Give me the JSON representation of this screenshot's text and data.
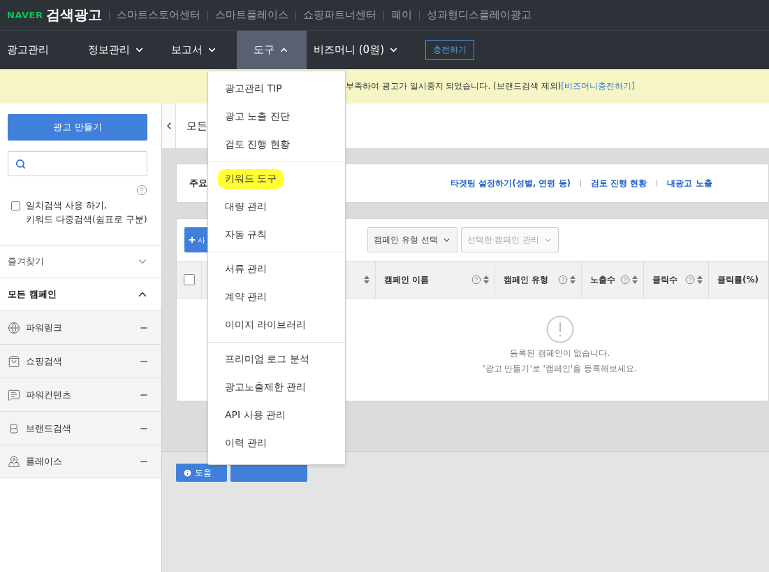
{
  "header": {
    "logo": "NAVER",
    "title": "검색광고",
    "links": [
      "스마트스토어센터",
      "스마트플레이스",
      "쇼핑파트너센터",
      "페이",
      "성과형디스플레이광고"
    ]
  },
  "nav": {
    "items": [
      {
        "label": "광고관리",
        "kind": "link",
        "selected": false
      },
      {
        "label": "정보관리",
        "kind": "menu",
        "expanded": false,
        "selected": false
      },
      {
        "label": "보고서",
        "kind": "menu",
        "expanded": false,
        "selected": false
      },
      {
        "label": "도구",
        "kind": "menu",
        "expanded": true,
        "selected": true
      },
      {
        "label": "비즈머니 (0원)",
        "kind": "menu",
        "expanded": false,
        "selected": false
      }
    ],
    "charge_button": "충전하기"
  },
  "dropdown": {
    "groups": [
      [
        {
          "label": "광고관리 TIP",
          "highlighted": false
        },
        {
          "label": "광고 노출 진단",
          "highlighted": false
        },
        {
          "label": "검토 진행 현황",
          "highlighted": false
        }
      ],
      [
        {
          "label": "키워드 도구",
          "highlighted": true
        },
        {
          "label": "대량 관리",
          "highlighted": false
        },
        {
          "label": "자동 규칙",
          "highlighted": false
        }
      ],
      [
        {
          "label": "서류 관리",
          "highlighted": false
        },
        {
          "label": "계약 관리",
          "highlighted": false
        },
        {
          "label": "이미지 라이브러리",
          "highlighted": false
        }
      ],
      [
        {
          "label": "프리미엄 로그 분석",
          "highlighted": false
        },
        {
          "label": "광고노출제한 관리",
          "highlighted": false
        },
        {
          "label": "API 사용 관리",
          "highlighted": false
        },
        {
          "label": "이력 관리",
          "highlighted": false
        }
      ]
    ]
  },
  "banner": {
    "text": "부족하여 광고가 일시중지 되었습니다. (브랜드검색 제외)",
    "link": "[비즈머니충전하기]"
  },
  "sidebar": {
    "create_button": "광고 만들기",
    "exact_match": {
      "lines": [
        "일치검색 사용 하기,",
        "키워드 다중검색(쉼표로 구분)"
      ],
      "checked": false
    },
    "favorites": {
      "label": "즐겨찾기",
      "expanded": false
    },
    "all_campaigns": {
      "label": "모든 캠페인",
      "expanded": true
    },
    "campaign_types": [
      {
        "label": "파워링크"
      },
      {
        "label": "쇼핑검색"
      },
      {
        "label": "파워컨텐츠"
      },
      {
        "label": "브랜드검색"
      },
      {
        "label": "플레이스"
      }
    ]
  },
  "content": {
    "title": "모든",
    "notice": {
      "title": "주요",
      "links": [
        "타겟팅 설정하기(성별, 연령 등)",
        "검토 진행 현황",
        "내광고 노출"
      ]
    },
    "toolbar": {
      "add_button": "사",
      "type_select": {
        "label": "캠페인 유형 선택",
        "disabled": false
      },
      "manage_select": {
        "label": "선택한 캠페인 관리",
        "disabled": true
      }
    },
    "table": {
      "select_all_checked": false,
      "columns": [
        {
          "help": false
        },
        {
          "label": "캠페인 이름",
          "help": true
        },
        {
          "label": "캠페인 유형",
          "help": true
        },
        {
          "label": "노출수",
          "help": true
        },
        {
          "label": "클릭수",
          "help": true
        },
        {
          "label": "클릭률(%)",
          "help": false
        }
      ],
      "empty_lines": [
        "등록된 캠페인이 없습니다.",
        "'광고 만들기'로 '캠페인'을 등록해보세요."
      ]
    },
    "footer_buttons": [
      {
        "label": "도움"
      }
    ]
  }
}
